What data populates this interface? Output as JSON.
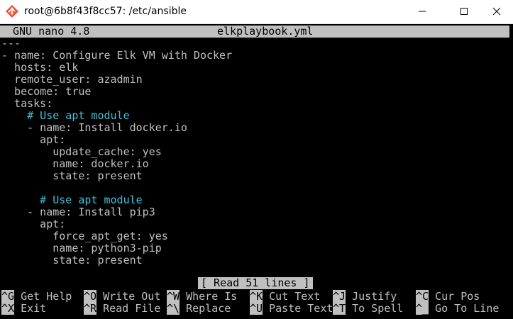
{
  "window": {
    "title": "root@6b8f43f8cc57: /etc/ansible"
  },
  "nano": {
    "version": "GNU nano 4.8",
    "filename": "elkplaybook.yml",
    "status": "[ Read 51 lines ]"
  },
  "lines": [
    {
      "text": "---",
      "type": "code"
    },
    {
      "text": "- name: Configure Elk VM with Docker",
      "type": "code"
    },
    {
      "text": "  hosts: elk",
      "type": "code"
    },
    {
      "text": "  remote_user: azadmin",
      "type": "code"
    },
    {
      "text": "  become: true",
      "type": "code"
    },
    {
      "text": "  tasks:",
      "type": "code"
    },
    {
      "text": "    # Use apt module",
      "type": "comment"
    },
    {
      "text": "    - name: Install docker.io",
      "type": "code"
    },
    {
      "text": "      apt:",
      "type": "code"
    },
    {
      "text": "        update_cache: yes",
      "type": "code"
    },
    {
      "text": "        name: docker.io",
      "type": "code"
    },
    {
      "text": "        state: present",
      "type": "code"
    },
    {
      "text": "",
      "type": "code"
    },
    {
      "text": "      # Use apt module",
      "type": "comment"
    },
    {
      "text": "    - name: Install pip3",
      "type": "code"
    },
    {
      "text": "      apt:",
      "type": "code"
    },
    {
      "text": "        force_apt_get: yes",
      "type": "code"
    },
    {
      "text": "        name: python3-pip",
      "type": "code"
    },
    {
      "text": "        state: present",
      "type": "code"
    }
  ],
  "shortcuts": [
    {
      "key": "^G",
      "label": " Get Help"
    },
    {
      "key": "^O",
      "label": " Write Out"
    },
    {
      "key": "^W",
      "label": " Where Is"
    },
    {
      "key": "^K",
      "label": " Cut Text"
    },
    {
      "key": "^J",
      "label": " Justify"
    },
    {
      "key": "^C",
      "label": " Cur Pos"
    },
    {
      "key": "^X",
      "label": " Exit"
    },
    {
      "key": "^R",
      "label": " Read File"
    },
    {
      "key": "^\\",
      "label": " Replace"
    },
    {
      "key": "^U",
      "label": " Paste Text"
    },
    {
      "key": "^T",
      "label": " To Spell"
    },
    {
      "key": "^_",
      "label": " Go To Line"
    }
  ],
  "colors": {
    "terminal_bg": "#000000",
    "terminal_fg": "#c0c0c0",
    "comment": "#3fc0d8",
    "bar_bg": "#c0c0c0"
  },
  "icons": {
    "app": "git-bash-diamond-icon",
    "minimize": "minimize-icon",
    "maximize": "maximize-icon",
    "close": "close-icon"
  }
}
